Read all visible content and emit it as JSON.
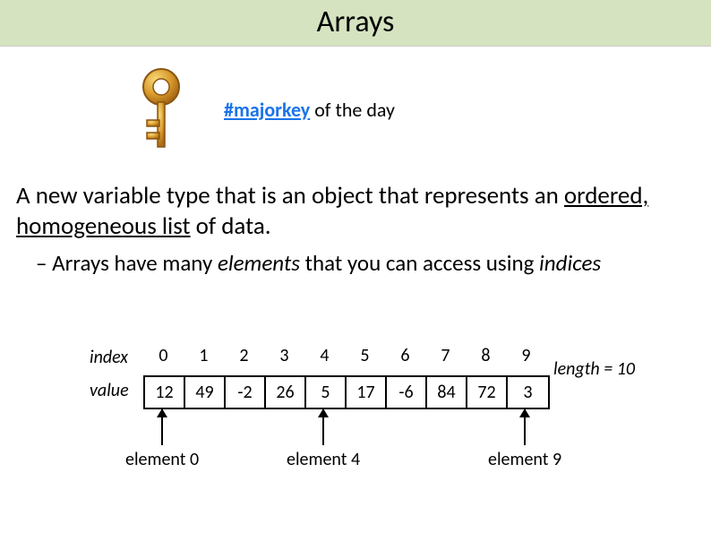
{
  "title": "Arrays",
  "hashtag": "#majorkey",
  "hashtag_suffix": " of the day",
  "desc_pre": "A new variable type that is an object that represents an ",
  "desc_uline": "ordered, homogeneous list",
  "desc_post": " of data.",
  "subdesc_pre": "– Arrays have many ",
  "subdesc_i1": "elements",
  "subdesc_mid": " that you can access using ",
  "subdesc_i2": "indices",
  "row_index_label": "index",
  "row_value_label": "value",
  "length_label": "length = 10",
  "pointer_labels": {
    "e0": "element 0",
    "e4": "element 4",
    "e9": "element 9"
  },
  "chart_data": {
    "type": "table",
    "title": "Array indices and values",
    "indices": [
      0,
      1,
      2,
      3,
      4,
      5,
      6,
      7,
      8,
      9
    ],
    "values": [
      12,
      49,
      -2,
      26,
      5,
      17,
      -6,
      84,
      72,
      3
    ],
    "length": 10
  }
}
